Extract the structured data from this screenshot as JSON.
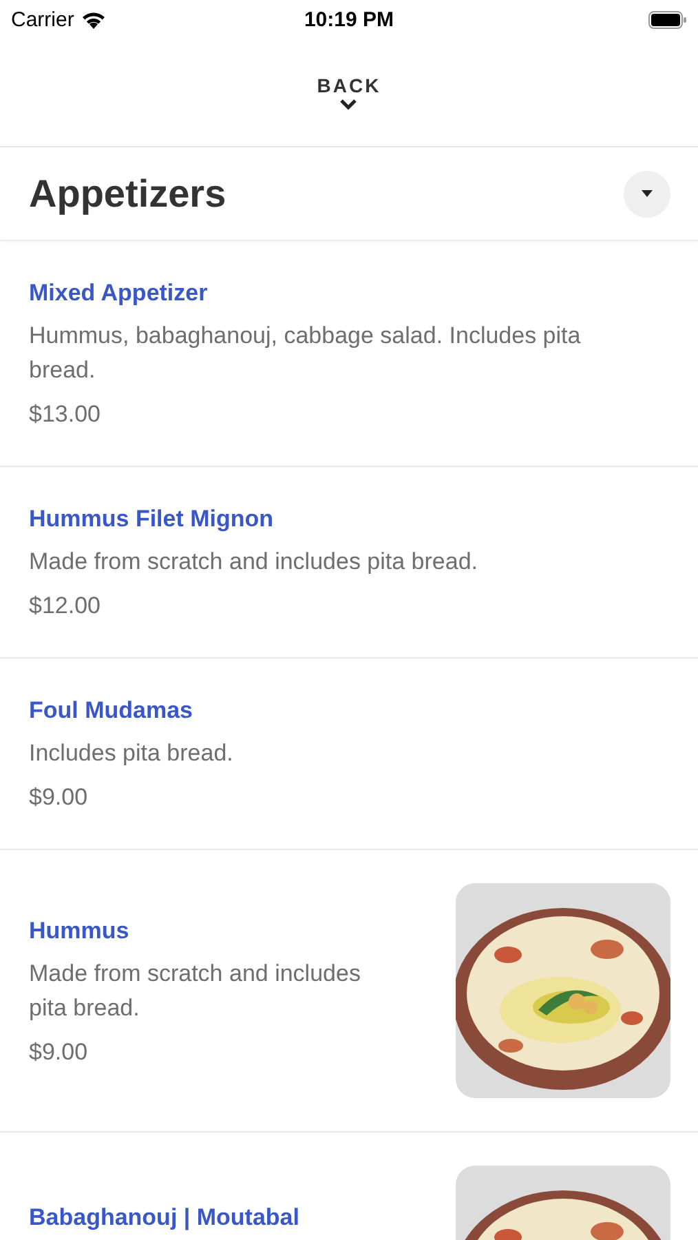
{
  "status_bar": {
    "carrier": "Carrier",
    "time": "10:19 PM"
  },
  "back_button": {
    "label": "BACK"
  },
  "section": {
    "title": "Appetizers"
  },
  "items": [
    {
      "kind": "text",
      "name": "Mixed Appetizer",
      "description": "Hummus, babaghanouj, cabbage salad. Includes pita bread.",
      "price": "$13.00"
    },
    {
      "kind": "text",
      "name": "Hummus Filet Mignon",
      "description": "Made from scratch and includes pita bread.",
      "price": "$12.00"
    },
    {
      "kind": "text",
      "name": "Foul Mudamas",
      "description": "Includes pita bread.",
      "price": "$9.00"
    },
    {
      "kind": "with_picture",
      "name": "Hummus",
      "description": "Made from scratch and includes pita bread.",
      "price": "$9.00"
    },
    {
      "kind": "with_picture",
      "name": "Babaghanouj | Moutabal"
    }
  ]
}
